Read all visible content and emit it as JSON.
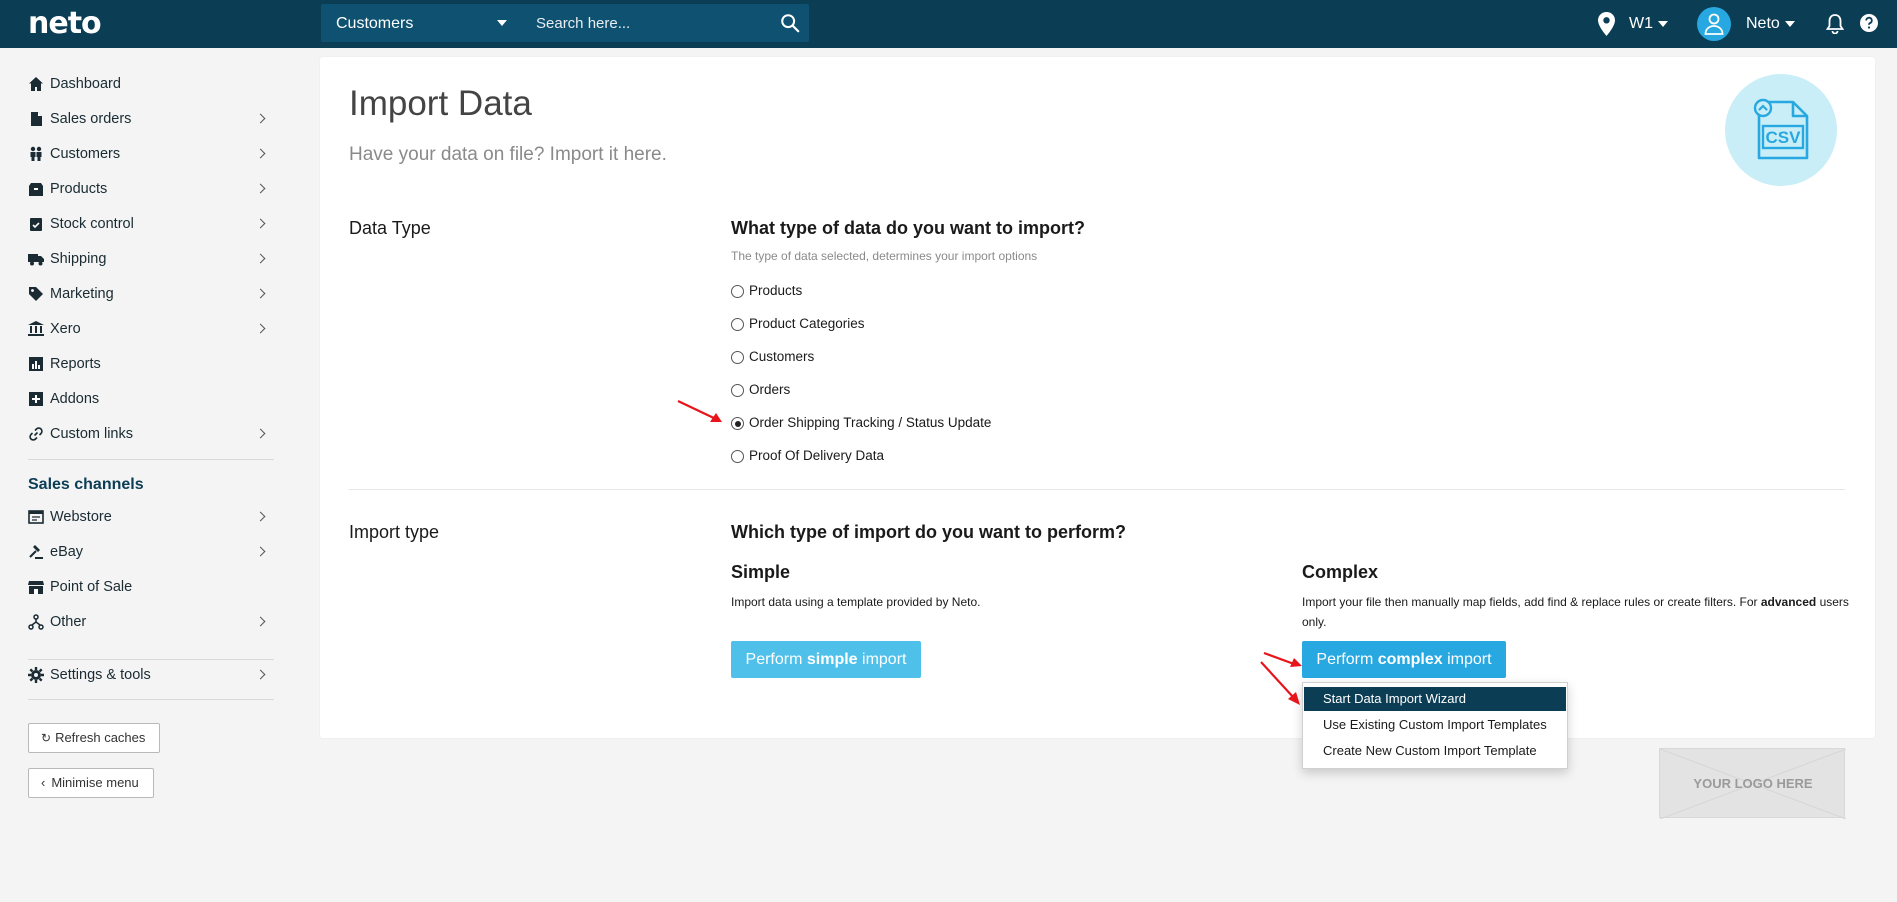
{
  "topbar": {
    "logo": "neto",
    "search_scope": "Customers",
    "search_placeholder": "Search here...",
    "location": "W1",
    "user": "Neto"
  },
  "sidebar": {
    "items": [
      {
        "label": "Dashboard",
        "icon": "home-icon",
        "has_chevron": false
      },
      {
        "label": "Sales orders",
        "icon": "document-icon",
        "has_chevron": true
      },
      {
        "label": "Customers",
        "icon": "people-icon",
        "has_chevron": true
      },
      {
        "label": "Products",
        "icon": "box-icon",
        "has_chevron": true
      },
      {
        "label": "Stock control",
        "icon": "clipboard-check-icon",
        "has_chevron": true
      },
      {
        "label": "Shipping",
        "icon": "truck-icon",
        "has_chevron": true
      },
      {
        "label": "Marketing",
        "icon": "tag-icon",
        "has_chevron": true
      },
      {
        "label": "Xero",
        "icon": "bank-icon",
        "has_chevron": true
      },
      {
        "label": "Reports",
        "icon": "chart-icon",
        "has_chevron": false
      },
      {
        "label": "Addons",
        "icon": "plus-square-icon",
        "has_chevron": false
      },
      {
        "label": "Custom links",
        "icon": "link-icon",
        "has_chevron": true
      }
    ],
    "channels_title": "Sales channels",
    "channels": [
      {
        "label": "Webstore",
        "icon": "browser-icon",
        "has_chevron": true
      },
      {
        "label": "eBay",
        "icon": "gavel-icon",
        "has_chevron": true
      },
      {
        "label": "Point of Sale",
        "icon": "store-icon",
        "has_chevron": false
      },
      {
        "label": "Other",
        "icon": "branch-icon",
        "has_chevron": true
      }
    ],
    "settings": {
      "label": "Settings & tools",
      "icon": "gear-icon"
    },
    "refresh_label": "Refresh caches",
    "minimise_label": "Minimise menu"
  },
  "main": {
    "title": "Import Data",
    "subtitle": "Have your data on file? Import it here.",
    "csv_label": "CSV",
    "data_type": {
      "section_label": "Data Type",
      "question": "What type of data do you want to import?",
      "help": "The type of data selected, determines your import options",
      "options": [
        {
          "label": "Products",
          "selected": false
        },
        {
          "label": "Product Categories",
          "selected": false
        },
        {
          "label": "Customers",
          "selected": false
        },
        {
          "label": "Orders",
          "selected": false
        },
        {
          "label": "Order Shipping Tracking / Status Update",
          "selected": true
        },
        {
          "label": "Proof Of Delivery Data",
          "selected": false
        }
      ]
    },
    "import_type": {
      "section_label": "Import type",
      "question": "Which type of import do you want to perform?",
      "simple": {
        "title": "Simple",
        "desc": "Import data using a template provided by Neto.",
        "button_pre": "Perform ",
        "button_bold": "simple",
        "button_post": " import"
      },
      "complex": {
        "title": "Complex",
        "desc_pre": "Import your file then manually map fields, add find & replace rules or create filters. For ",
        "desc_bold": "advanced",
        "desc_post": " users only.",
        "button_pre": "Perform ",
        "button_bold": "complex",
        "button_post": " import",
        "menu": [
          "Start Data Import Wizard",
          "Use Existing Custom Import Templates",
          "Create New Custom Import Template"
        ]
      }
    },
    "logo_placeholder": "YOUR LOGO HERE"
  },
  "colors": {
    "topbar": "#0b3d55",
    "accent": "#28a8e0",
    "accent_light": "#4fc0ea",
    "annotation_arrow": "#e8141b"
  }
}
